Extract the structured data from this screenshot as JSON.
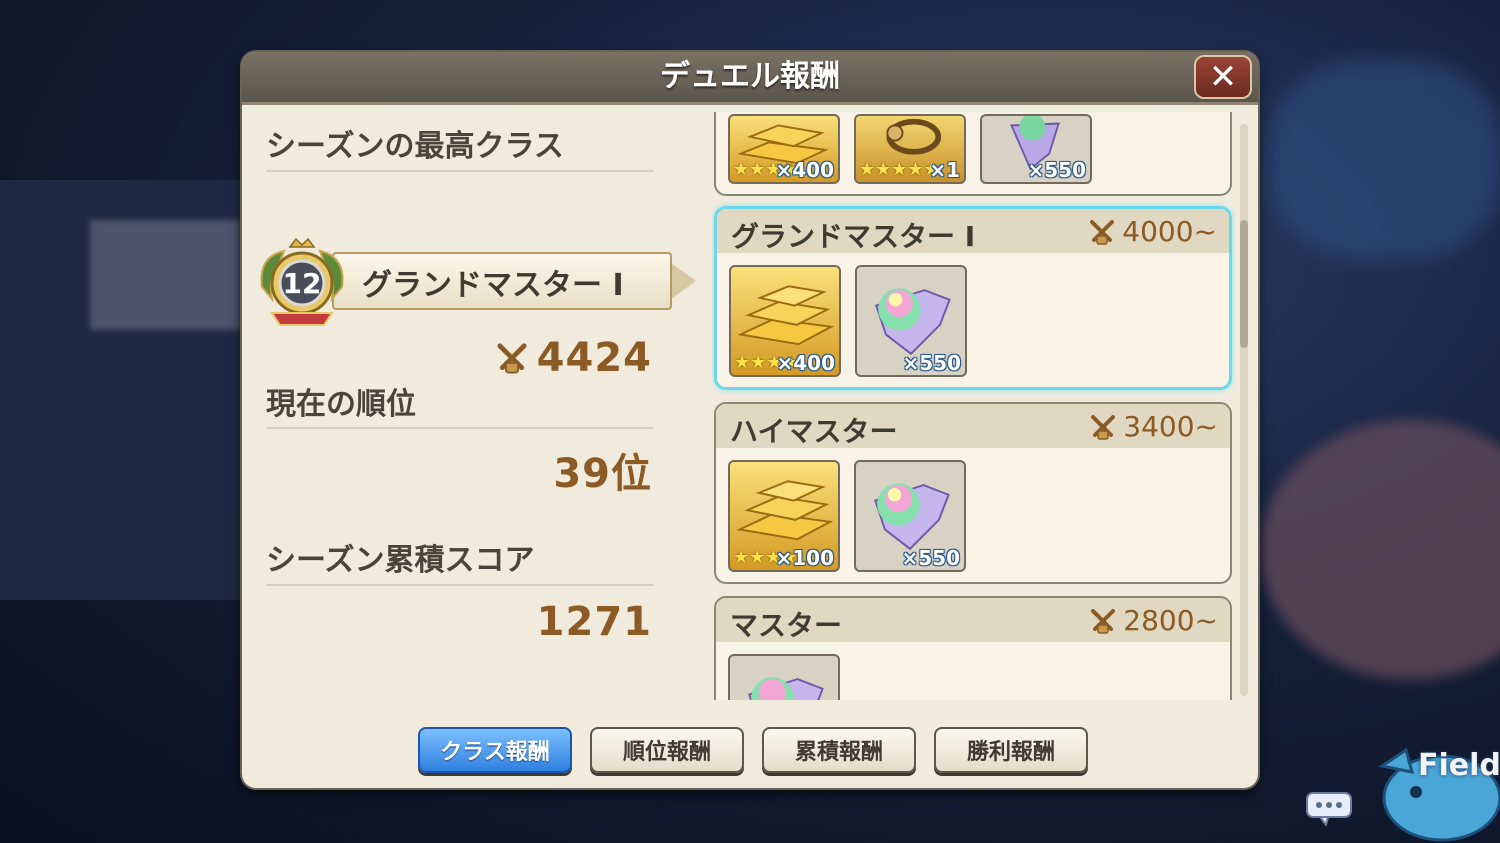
{
  "dialog": {
    "title": "デュエル報酬"
  },
  "left": {
    "season_best_label": "シーズンの最高クラス",
    "rank_number": "12",
    "rank_name": "グランドマスター Ⅰ",
    "best_score": "4424",
    "current_rank_label": "現在の順位",
    "current_rank_value": "39位",
    "season_score_label": "シーズン累積スコア",
    "season_score_value": "1271"
  },
  "rewards": {
    "top_partial_items": [
      {
        "icon": "gold-bars-icon",
        "stars": "★★★★",
        "label": "×400"
      },
      {
        "icon": "lasso-icon",
        "stars": "★★★★★",
        "label": "×1"
      },
      {
        "icon": "rainbow-gem-icon",
        "stars": "",
        "label": "×550"
      }
    ],
    "cards": [
      {
        "title": "グランドマスター Ⅰ",
        "score": "4000~",
        "selected": true,
        "items": [
          {
            "icon": "gold-bars-icon",
            "stars": "★★★★",
            "label": "×400"
          },
          {
            "icon": "rainbow-gem-icon",
            "stars": "",
            "label": "×550"
          }
        ]
      },
      {
        "title": "ハイマスター",
        "score": "3400~",
        "selected": false,
        "items": [
          {
            "icon": "gold-bars-icon",
            "stars": "★★★★",
            "label": "×100"
          },
          {
            "icon": "rainbow-gem-icon",
            "stars": "",
            "label": "×550"
          }
        ]
      },
      {
        "title": "マスター",
        "score": "2800~",
        "selected": false,
        "items": [
          {
            "icon": "rainbow-gem-icon",
            "stars": "",
            "label": ""
          }
        ]
      }
    ]
  },
  "tabs": [
    {
      "label": "クラス報酬",
      "active": true
    },
    {
      "label": "順位報酬",
      "active": false
    },
    {
      "label": "累積報酬",
      "active": false
    },
    {
      "label": "勝利報酬",
      "active": false
    }
  ],
  "overlay": {
    "field_label": "Field"
  },
  "colors": {
    "accent_blue": "#2f7fe0",
    "score_brown": "#8b5a25",
    "selected_glow": "#6fd7e8"
  }
}
